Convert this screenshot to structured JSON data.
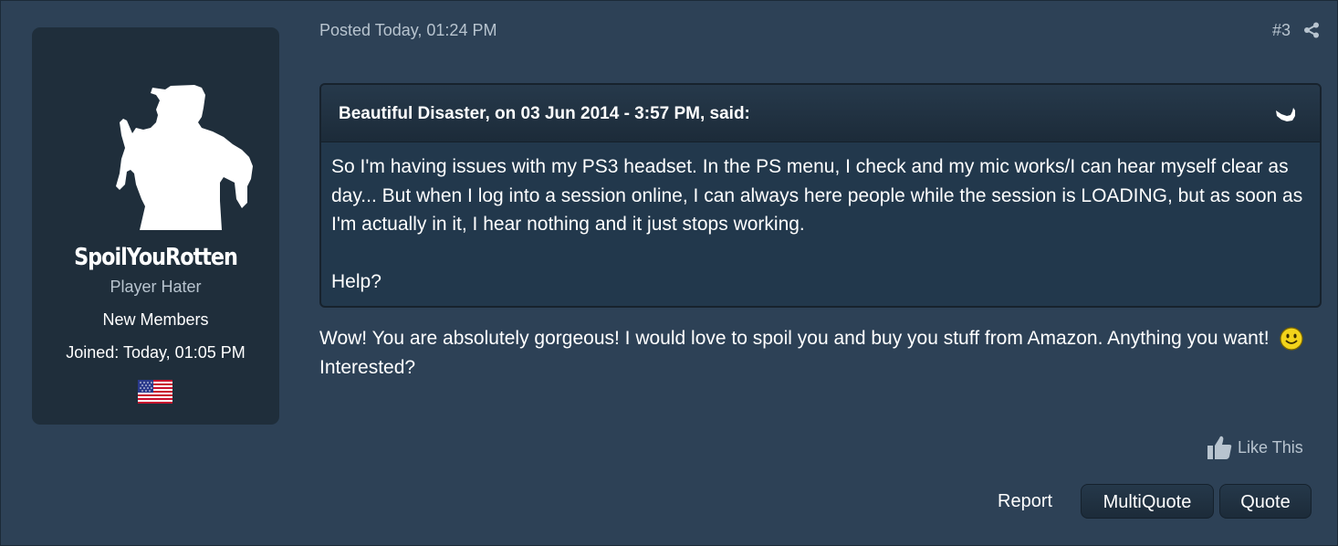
{
  "author": {
    "username": "SpoilYouRotten",
    "title": "Player Hater",
    "group": "New Members",
    "joined": "Joined: Today, 01:05 PM",
    "avatar_icon": "silhouette-avatar-icon",
    "flag_icon": "us-flag-icon"
  },
  "post": {
    "posted": "Posted Today, 01:24 PM",
    "number": "#3",
    "share_icon": "share-icon"
  },
  "quote": {
    "citation": "Beautiful Disaster, on 03 Jun 2014 - 3:57 PM, said:",
    "line1": "So I'm having issues with my PS3 headset. In the PS menu, I check and my mic works/I can hear myself clear as day... But when I log into a session online, I can always here people while the session is LOADING, but as soon as I'm actually in it, I hear nothing and it just stops working.",
    "line2": "Help?"
  },
  "reply": {
    "text_before": "Wow! You are absolutely gorgeous! I would love to spoil you and buy you stuff from Amazon. Anything you want!",
    "text_after": "Interested?",
    "emoji_icon": "smiley-icon"
  },
  "actions": {
    "like_label": "Like This",
    "report_label": "Report",
    "multiquote_label": "MultiQuote",
    "quote_label": "Quote"
  },
  "colors": {
    "background": "#2d4156",
    "panel": "#1f2e3b",
    "muted_text": "#b8c4cf",
    "text": "#ffffff"
  }
}
